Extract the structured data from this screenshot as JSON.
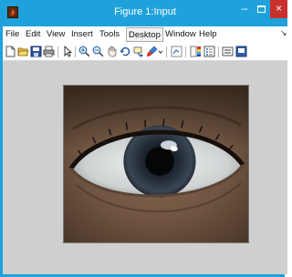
{
  "window": {
    "title": "Figure 1:Input",
    "minimize_symbol": "–",
    "close_symbol": "×",
    "accent_color": "#1fa2dc"
  },
  "menubar": {
    "items": [
      {
        "label": "File"
      },
      {
        "label": "Edit"
      },
      {
        "label": "View"
      },
      {
        "label": "Insert"
      },
      {
        "label": "Tools"
      },
      {
        "label": "Desktop",
        "active": true
      },
      {
        "label": "Window"
      },
      {
        "label": "Help"
      }
    ],
    "overflow": "↘"
  },
  "toolbar": {
    "icons": [
      "new-figure-icon",
      "open-file-icon",
      "save-icon",
      "print-icon",
      "pointer-icon",
      "zoom-in-icon",
      "zoom-out-icon",
      "pan-icon",
      "rotate-3d-icon",
      "data-cursor-icon",
      "brush-icon",
      "dropdown-icon",
      "link-plot-icon",
      "colorbar-icon",
      "legend-icon",
      "hide-plot-tools-icon",
      "show-plot-tools-icon"
    ]
  },
  "figure": {
    "image_subject": "close-up of a human eye",
    "background_color": "#cfcfcf"
  }
}
